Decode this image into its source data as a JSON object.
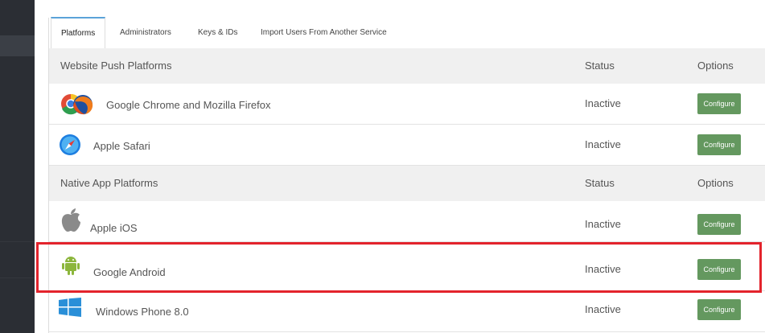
{
  "tabs": [
    {
      "label": "Platforms",
      "active": true
    },
    {
      "label": "Administrators",
      "active": false
    },
    {
      "label": "Keys & IDs",
      "active": false
    },
    {
      "label": "Import Users From Another Service",
      "active": false
    }
  ],
  "website_section": {
    "title": "Website Push Platforms",
    "status_header": "Status",
    "options_header": "Options"
  },
  "native_section": {
    "title": "Native App Platforms",
    "status_header": "Status",
    "options_header": "Options"
  },
  "website_platforms": [
    {
      "name": "Google Chrome and Mozilla Firefox",
      "status": "Inactive",
      "button": "Configure",
      "icon": "chrome-firefox-icon"
    },
    {
      "name": "Apple Safari",
      "status": "Inactive",
      "button": "Configure",
      "icon": "safari-icon"
    }
  ],
  "native_platforms": [
    {
      "name": "Apple iOS",
      "status": "Inactive",
      "button": "Configure",
      "icon": "apple-icon"
    },
    {
      "name": "Google Android",
      "status": "Inactive",
      "button": "Configure",
      "icon": "android-icon"
    },
    {
      "name": "Windows Phone 8.0",
      "status": "Inactive",
      "button": "Configure",
      "icon": "windows-icon"
    }
  ],
  "colors": {
    "accent": "#5ba3d9",
    "button": "#64985f",
    "highlight": "#e3232c",
    "sidebar": "#2b2e34"
  }
}
